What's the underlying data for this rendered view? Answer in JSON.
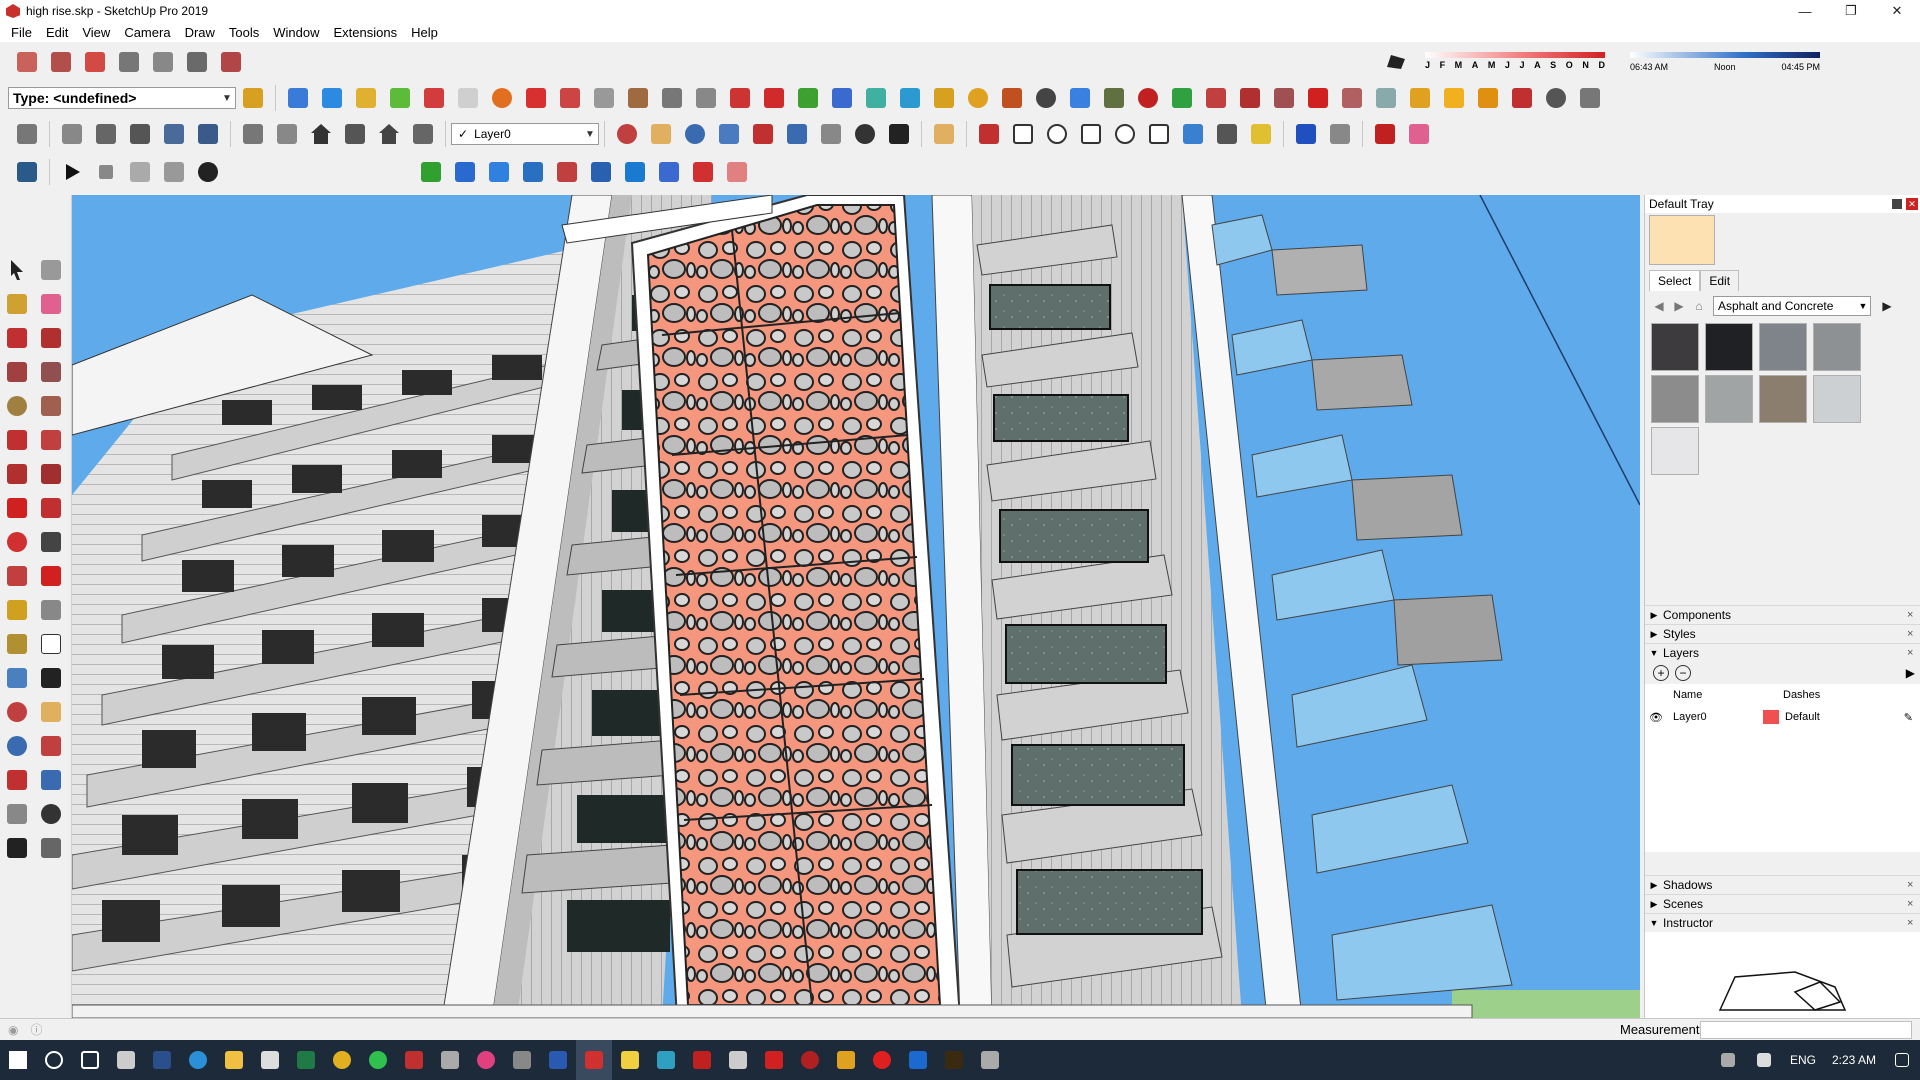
{
  "window": {
    "title": "high rise.skp - SketchUp Pro 2019",
    "minimize": "—",
    "maximize": "❐",
    "close": "✕"
  },
  "menu": [
    "File",
    "Edit",
    "View",
    "Camera",
    "Draw",
    "Tools",
    "Window",
    "Extensions",
    "Help"
  ],
  "toolbar": {
    "type_select": "Type: <undefined>",
    "layer_select": "Layer0",
    "layer_check": "✓"
  },
  "shadow": {
    "months": [
      "J",
      "F",
      "M",
      "A",
      "M",
      "J",
      "J",
      "A",
      "S",
      "O",
      "N",
      "D"
    ],
    "times": [
      "06:43 AM",
      "Noon",
      "04:45 PM"
    ]
  },
  "tray": {
    "title": "Default Tray",
    "tabs": [
      "Select",
      "Edit"
    ],
    "library": "Asphalt and Concrete",
    "swatch_colors": [
      "#3e3b3e",
      "#1f2124",
      "#7e848a",
      "#8e9194",
      "#8c8c8c",
      "#a0a4a4",
      "#8b7e6e",
      "#cdd0d3",
      "#e6e6e8"
    ],
    "panels": {
      "components": "Components",
      "styles": "Styles",
      "layers": "Layers",
      "shadows": "Shadows",
      "scenes": "Scenes",
      "instructor": "Instructor"
    },
    "layers_table": {
      "name_header": "Name",
      "dashes_header": "Dashes",
      "rows": [
        {
          "name": "Layer0",
          "dashes": "Default"
        }
      ]
    }
  },
  "status": {
    "measurements_label": "Measurements"
  },
  "taskbar": {
    "lang": "ENG",
    "time": "2:23 AM"
  }
}
